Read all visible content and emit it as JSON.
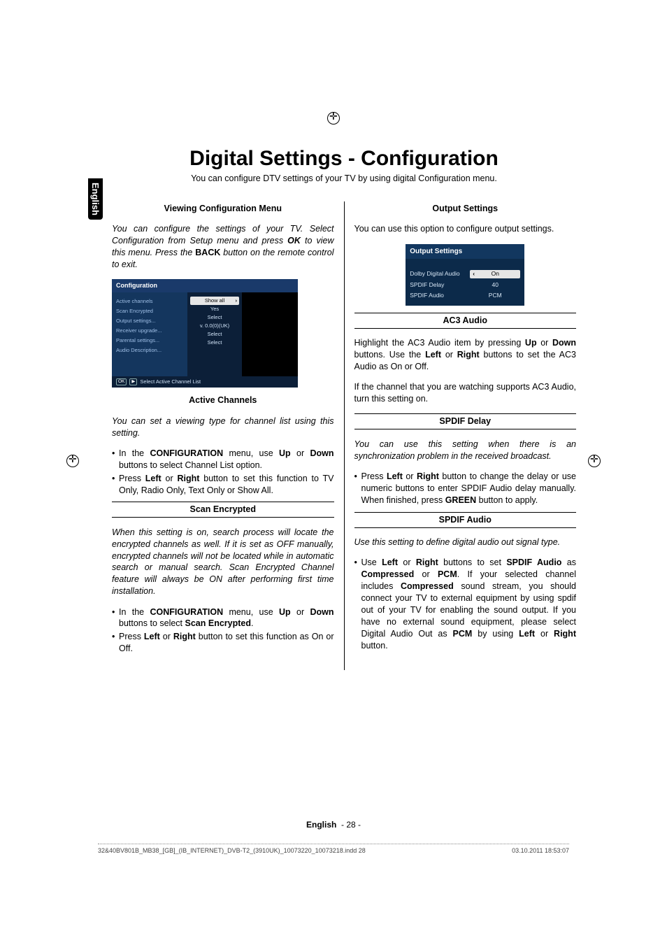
{
  "lang_tab": "English",
  "title": "Digital Settings - Configuration",
  "subtitle": "You can configure DTV settings of your TV by using digital Configuration menu.",
  "left": {
    "h_viewing": "Viewing Configuration Menu",
    "viewing_p1_a": "You can configure the settings of your TV. Select Configuration from Setup menu and press ",
    "viewing_p1_ok": "OK",
    "viewing_p1_b": " to view this menu. Press the ",
    "viewing_p1_back": "BACK",
    "viewing_p1_c": " button on the remote control to exit.",
    "osd": {
      "header": "Configuration",
      "nav": [
        "Active channels",
        "Scan Encrypted",
        "Output settings...",
        "Receiver upgrade...",
        "Parental settings...",
        "Audio Description..."
      ],
      "vals": [
        "Show all",
        "Yes",
        "Select",
        "v. 0.0(0)(UK)",
        "Select",
        "Select"
      ],
      "footer_btn1": "OK",
      "footer_btn2": "▶",
      "footer_txt": "Select Active Channel List"
    },
    "h_active": "Active Channels",
    "active_p1": "You can set a viewing type for channel list using this setting.",
    "active_b1_a": "In the ",
    "active_b1_conf": "CONFIGURATION",
    "active_b1_b": " menu, use ",
    "active_b1_up": "Up",
    "active_b1_c": " or ",
    "active_b1_down": "Down",
    "active_b1_d": " buttons to select Channel List option.",
    "active_b2_a": "Press ",
    "active_b2_left": "Left",
    "active_b2_b": " or ",
    "active_b2_right": "Right",
    "active_b2_c": " button to set this function to TV Only, Radio Only, Text Only or Show All.",
    "h_scan": "Scan Encrypted",
    "scan_p1": "When this setting is on, search process will locate the encrypted channels as well. If it is set as OFF manually, encrypted channels will not be located while in automatic search or manual search. Scan Encrypted Channel feature will always be ON after performing first time installation.",
    "scan_b1_a": "In the ",
    "scan_b1_conf": "CONFIGURATION",
    "scan_b1_b": " menu, use ",
    "scan_b1_up": "Up",
    "scan_b1_c": " or ",
    "scan_b1_down": "Down",
    "scan_b1_d": " buttons to select ",
    "scan_b1_se": "Scan Encrypted",
    "scan_b1_e": ".",
    "scan_b2_a": "Press ",
    "scan_b2_left": "Left",
    "scan_b2_b": " or ",
    "scan_b2_right": "Right",
    "scan_b2_c": " button to set this function as On or Off."
  },
  "right": {
    "h_output": "Output Settings",
    "output_p1": "You can use this option to configure output settings.",
    "osd2": {
      "header": "Output Settings",
      "rows": [
        {
          "lbl": "Dolby Digital Audio",
          "val": "On",
          "sel": true
        },
        {
          "lbl": "SPDIF Delay",
          "val": "40",
          "sel": false
        },
        {
          "lbl": "SPDIF Audio",
          "val": "PCM",
          "sel": false
        }
      ]
    },
    "h_ac3": "AC3 Audio",
    "ac3_p1_a": "Highlight the AC3 Audio item by pressing ",
    "ac3_p1_up": "Up",
    "ac3_p1_b": " or ",
    "ac3_p1_down": "Down",
    "ac3_p1_c": " buttons. Use the ",
    "ac3_p1_left": "Left",
    "ac3_p1_d": " or ",
    "ac3_p1_right": "Right",
    "ac3_p1_e": " buttons to set the AC3 Audio as On or Off.",
    "ac3_p2": "If the channel that you are watching supports AC3 Audio, turn this setting on.",
    "h_spdif_delay": "SPDIF Delay",
    "spdif_delay_p1": "You can use this setting when there is an synchronization problem in the received broadcast.",
    "spdif_delay_b1_a": "Press ",
    "spdif_delay_b1_left": "Left",
    "spdif_delay_b1_b": " or ",
    "spdif_delay_b1_right": "Right",
    "spdif_delay_b1_c": " button to change the delay or use numeric buttons to enter SPDIF Audio delay manually. When finished, press ",
    "spdif_delay_b1_green": "GREEN",
    "spdif_delay_b1_d": " button to apply.",
    "h_spdif_audio": "SPDIF Audio",
    "spdif_audio_p1": "Use this setting to define digital audio out signal type.",
    "spdif_audio_b1_a": "Use ",
    "spdif_audio_b1_left": "Left",
    "spdif_audio_b1_b": " or ",
    "spdif_audio_b1_right": "Right",
    "spdif_audio_b1_c": " buttons to set ",
    "spdif_audio_b1_spdif": "SPDIF Audio",
    "spdif_audio_b1_d": " as ",
    "spdif_audio_b1_comp": "Compressed",
    "spdif_audio_b1_e": " or ",
    "spdif_audio_b1_pcm": "PCM",
    "spdif_audio_b1_f": ". If your selected channel includes ",
    "spdif_audio_b1_comp2": "Compressed",
    "spdif_audio_b1_g": " sound stream, you should connect your TV to external equipment by using spdif out of your TV for enabling the sound output. If you have no external sound equipment, please select Digital Audio Out as ",
    "spdif_audio_b1_pcm2": "PCM",
    "spdif_audio_b1_h": " by using ",
    "spdif_audio_b1_left2": "Left",
    "spdif_audio_b1_i": " or ",
    "spdif_audio_b1_right2": "Right",
    "spdif_audio_b1_j": " button."
  },
  "footer_lang": "English",
  "footer_page": "- 28 -",
  "footline_left": "32&40BV801B_MB38_[GB]_(IB_INTERNET)_DVB-T2_(3910UK)_10073220_10073218.indd   28",
  "footline_right": "03.10.2011   18:53:07"
}
